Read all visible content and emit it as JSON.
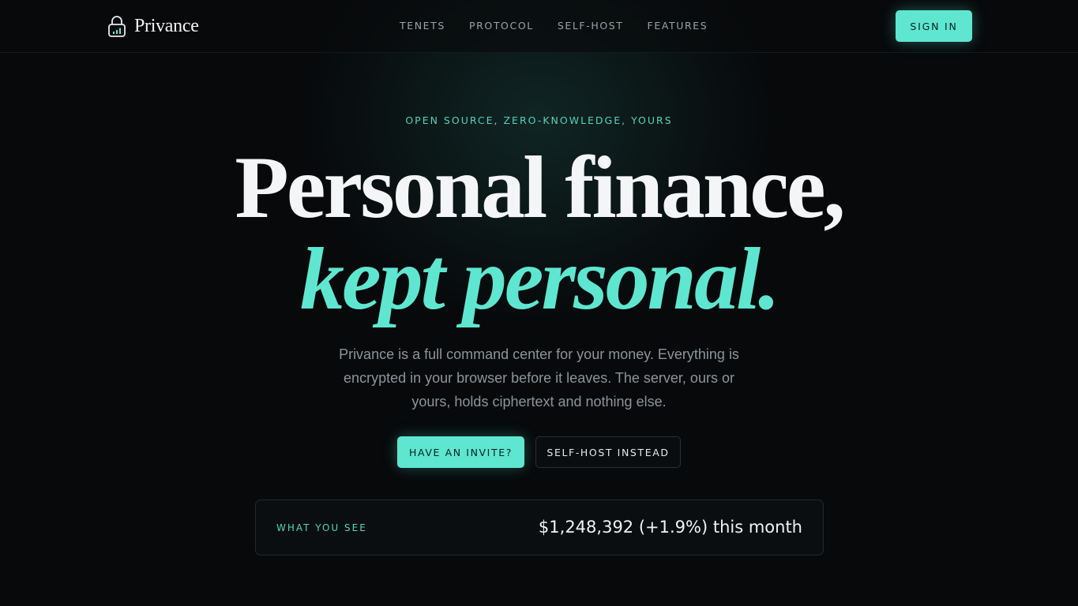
{
  "header": {
    "brand_name": "Privance",
    "brand_icon": "lock-chart-icon",
    "nav": [
      {
        "label": "TENETS"
      },
      {
        "label": "PROTOCOL"
      },
      {
        "label": "SELF-HOST"
      },
      {
        "label": "FEATURES"
      }
    ],
    "signin_label": "SIGN IN"
  },
  "hero": {
    "eyebrow": "OPEN SOURCE, ZERO-KNOWLEDGE, YOURS",
    "headline_line1": "Personal finance,",
    "headline_line2": "kept personal.",
    "subcopy": "Privance is a full command center for your money. Everything is encrypted in your browser before it leaves. The server, ours or yours, holds ciphertext and nothing else.",
    "primary_cta": "HAVE AN INVITE?",
    "secondary_cta": "SELF-HOST INSTEAD"
  },
  "preview": {
    "label": "WHAT YOU SEE",
    "value": "$1,248,392 (+1.9%) this month"
  },
  "colors": {
    "accent": "#5ee6d0",
    "background": "#07090b",
    "muted_text": "#8c959a"
  }
}
